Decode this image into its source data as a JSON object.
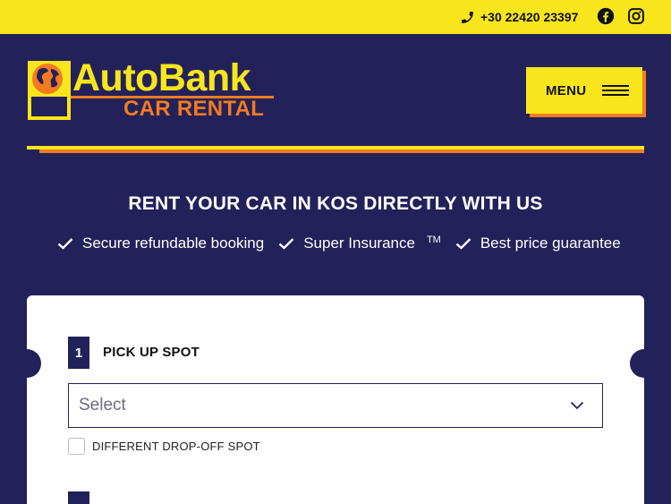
{
  "topbar": {
    "phone": "+30 22420 23397",
    "icons": [
      "phone-icon",
      "facebook-icon",
      "instagram-icon"
    ]
  },
  "logo": {
    "title": "AutoBank",
    "subtitle": "CAR RENTAL"
  },
  "nav": {
    "menu_label": "MENU"
  },
  "hero": {
    "headline": "RENT YOUR CAR IN KOS DIRECTLY WITH US",
    "features": [
      {
        "label": "Secure refundable booking",
        "sup": ""
      },
      {
        "label": "Super Insurance",
        "sup": "TM"
      },
      {
        "label": "Best price guarantee",
        "sup": ""
      }
    ]
  },
  "booking": {
    "step1": {
      "number": "1",
      "label": "PICK UP SPOT",
      "select_value": "Select"
    },
    "dropoff_checkbox": {
      "label": "DIFFERENT DROP-OFF SPOT",
      "checked": false
    }
  },
  "colors": {
    "navy": "#23215a",
    "yellow": "#f8e51c",
    "orange": "#f47b20"
  }
}
